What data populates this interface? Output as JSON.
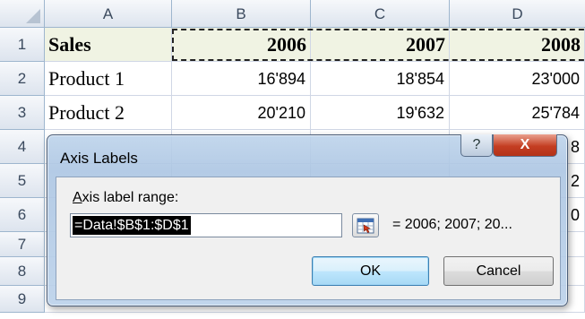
{
  "sheet": {
    "columns": [
      "A",
      "B",
      "C",
      "D"
    ],
    "rows": [
      "1",
      "2",
      "3",
      "4",
      "5",
      "6",
      "7",
      "8",
      "9"
    ],
    "header_row": {
      "label": "Sales",
      "y2006": "2006",
      "y2007": "2007",
      "y2008": "2008"
    },
    "data_rows": [
      {
        "label": "Product 1",
        "v2006": "16'894",
        "v2007": "18'854",
        "v2008": "23'000"
      },
      {
        "label": "Product 2",
        "v2006": "20'210",
        "v2007": "19'632",
        "v2008": "25'784"
      }
    ],
    "peek_digits": [
      "8",
      "2",
      "0"
    ]
  },
  "dialog": {
    "title": "Axis Labels",
    "help_glyph": "?",
    "close_glyph": "X",
    "range_label_accel": "A",
    "range_label_rest": "xis label range:",
    "range_value": "=Data!$B$1:$D$1",
    "preview": "= 2006; 2007; 20...",
    "ok_label": "OK",
    "cancel_label": "Cancel"
  },
  "colors": {
    "grid": "#d0d7e5",
    "header_fill": "#f0f3e3",
    "dialog_frame": "#b4cbe6",
    "close_red": "#c43e22"
  }
}
